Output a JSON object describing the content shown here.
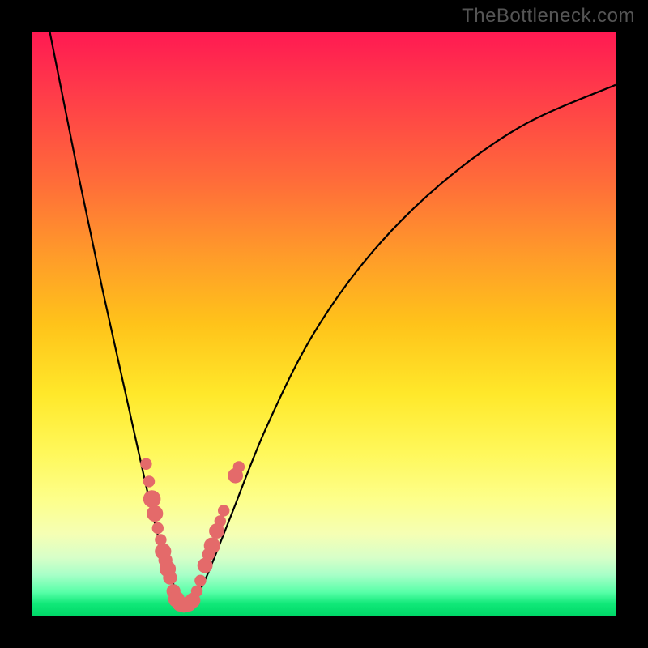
{
  "watermark": "TheBottleneck.com",
  "chart_data": {
    "type": "line",
    "title": "",
    "xlabel": "",
    "ylabel": "",
    "xlim": [
      0,
      100
    ],
    "ylim": [
      0,
      100
    ],
    "comment": "Axes are unlabeled; values expressed as percent of plot width/height (0,0 = bottom-left). Curve shows bottleneck magnitude dropping to a minimum near the balanced point then rising asymptotically. Dots are sample markers clustered near the minimum.",
    "series": [
      {
        "name": "bottleneck-curve",
        "x": [
          0,
          4,
          8,
          12,
          16,
          20,
          22,
          24,
          25,
          26,
          27,
          28,
          30,
          34,
          40,
          48,
          58,
          70,
          84,
          100
        ],
        "y": [
          115,
          95,
          75,
          56,
          38,
          20,
          12,
          6,
          3,
          2,
          2,
          3,
          7,
          17,
          32,
          48,
          62,
          74,
          84,
          91
        ]
      }
    ],
    "markers": [
      {
        "x": 19.5,
        "y": 26,
        "r": 1.0
      },
      {
        "x": 20.0,
        "y": 23,
        "r": 1.0
      },
      {
        "x": 20.5,
        "y": 20,
        "r": 1.5
      },
      {
        "x": 21.0,
        "y": 17.5,
        "r": 1.4
      },
      {
        "x": 21.5,
        "y": 15,
        "r": 1.0
      },
      {
        "x": 22.0,
        "y": 13,
        "r": 1.0
      },
      {
        "x": 22.4,
        "y": 11,
        "r": 1.4
      },
      {
        "x": 22.8,
        "y": 9.5,
        "r": 1.2
      },
      {
        "x": 23.2,
        "y": 8,
        "r": 1.4
      },
      {
        "x": 23.6,
        "y": 6.5,
        "r": 1.2
      },
      {
        "x": 24.2,
        "y": 4.2,
        "r": 1.2
      },
      {
        "x": 24.7,
        "y": 2.8,
        "r": 1.4
      },
      {
        "x": 25.3,
        "y": 2.0,
        "r": 1.3
      },
      {
        "x": 26.0,
        "y": 1.8,
        "r": 1.3
      },
      {
        "x": 26.8,
        "y": 2.0,
        "r": 1.3
      },
      {
        "x": 27.5,
        "y": 2.6,
        "r": 1.3
      },
      {
        "x": 28.2,
        "y": 4.2,
        "r": 1.0
      },
      {
        "x": 28.8,
        "y": 6.0,
        "r": 1.0
      },
      {
        "x": 29.6,
        "y": 8.6,
        "r": 1.3
      },
      {
        "x": 30.2,
        "y": 10.5,
        "r": 1.1
      },
      {
        "x": 30.8,
        "y": 12.0,
        "r": 1.4
      },
      {
        "x": 31.6,
        "y": 14.5,
        "r": 1.3
      },
      {
        "x": 32.2,
        "y": 16.2,
        "r": 1.0
      },
      {
        "x": 32.8,
        "y": 18.0,
        "r": 1.0
      },
      {
        "x": 34.8,
        "y": 24.0,
        "r": 1.3
      },
      {
        "x": 35.4,
        "y": 25.5,
        "r": 1.0
      }
    ]
  },
  "colors": {
    "curve": "#000000",
    "dot": "#e46a6a",
    "frame": "#000000"
  }
}
